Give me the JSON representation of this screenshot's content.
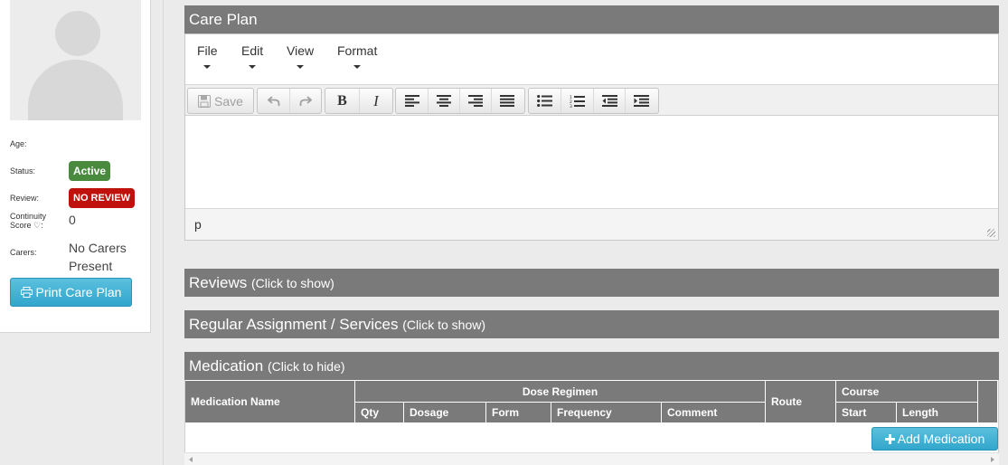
{
  "profile": {
    "age_label": "Age:",
    "status_label": "Status:",
    "status_value": "Active",
    "review_label": "Review:",
    "review_value": "NO REVIEW",
    "continuity_label_line1": "Continuity",
    "continuity_label_line2": "Score ♡:",
    "continuity_value": "0",
    "carers_label": "Carers:",
    "carers_value_line1": "No Carers",
    "carers_value_line2": "Present",
    "print_button": "Print Care Plan",
    "print_icon": "print-icon"
  },
  "colors": {
    "status_active": "#4a8a3f",
    "review_none": "#c0120c",
    "header_bg": "#7a7a7a",
    "button_info": "#31a6cc"
  },
  "care_plan": {
    "title": "Care Plan",
    "menus": [
      "File",
      "Edit",
      "View",
      "Format"
    ],
    "toolbar": {
      "save_label": "Save",
      "save_icon": "floppy-icon",
      "undo_icon": "undo-icon",
      "redo_icon": "redo-icon",
      "bold": "B",
      "italic": "I",
      "align_icons": [
        "align-left-icon",
        "align-center-icon",
        "align-right-icon",
        "align-justify-icon"
      ],
      "list_icons": [
        "bullet-list-icon",
        "numbered-list-icon",
        "outdent-icon",
        "indent-icon"
      ]
    },
    "status_path": "p"
  },
  "sections": {
    "reviews_title": "Reviews",
    "reviews_hint": "(Click to show)",
    "regular_title": "Regular Assignment / Services",
    "regular_hint": "(Click to show)",
    "medication_title": "Medication",
    "medication_hint": "(Click to hide)"
  },
  "medication_table": {
    "col_name": "Medication Name",
    "group_dose": "Dose Regimen",
    "dose_cols": [
      "Qty",
      "Dosage",
      "Form",
      "Frequency",
      "Comment"
    ],
    "col_route": "Route",
    "group_course": "Course",
    "course_cols": [
      "Start",
      "Length"
    ],
    "add_button": "Add Medication"
  }
}
